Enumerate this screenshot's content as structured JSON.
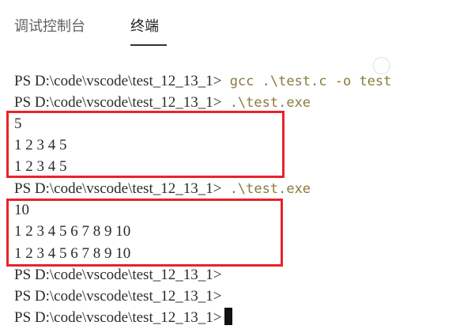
{
  "tabs": [
    {
      "label": "调试控制台",
      "active": false
    },
    {
      "label": "终端",
      "active": true
    }
  ],
  "terminal": {
    "lines": [
      {
        "prompt": "PS D:\\code\\vscode\\test_12_13_1>",
        "command": " gcc .\\test.c -o test"
      },
      {
        "prompt": "PS D:\\code\\vscode\\test_12_13_1>",
        "command": " .\\test.exe"
      },
      {
        "output": "5"
      },
      {
        "output": "1 2 3 4 5"
      },
      {
        "output": "1 2 3 4 5"
      },
      {
        "prompt": "PS D:\\code\\vscode\\test_12_13_1>",
        "command": " .\\test.exe"
      },
      {
        "output": "10"
      },
      {
        "output": "1 2 3 4 5 6 7 8 9 10"
      },
      {
        "output": "1 2 3 4 5 6 7 8 9 10"
      },
      {
        "prompt": "PS D:\\code\\vscode\\test_12_13_1>"
      },
      {
        "prompt": "PS D:\\code\\vscode\\test_12_13_1>"
      },
      {
        "prompt": "PS D:\\code\\vscode\\test_12_13_1>",
        "cursor": true
      }
    ]
  },
  "annotations": {
    "box_color": "#e8232b"
  },
  "colors": {
    "command_text": "#8a7a3c",
    "prompt_text": "#2b2b2b"
  }
}
